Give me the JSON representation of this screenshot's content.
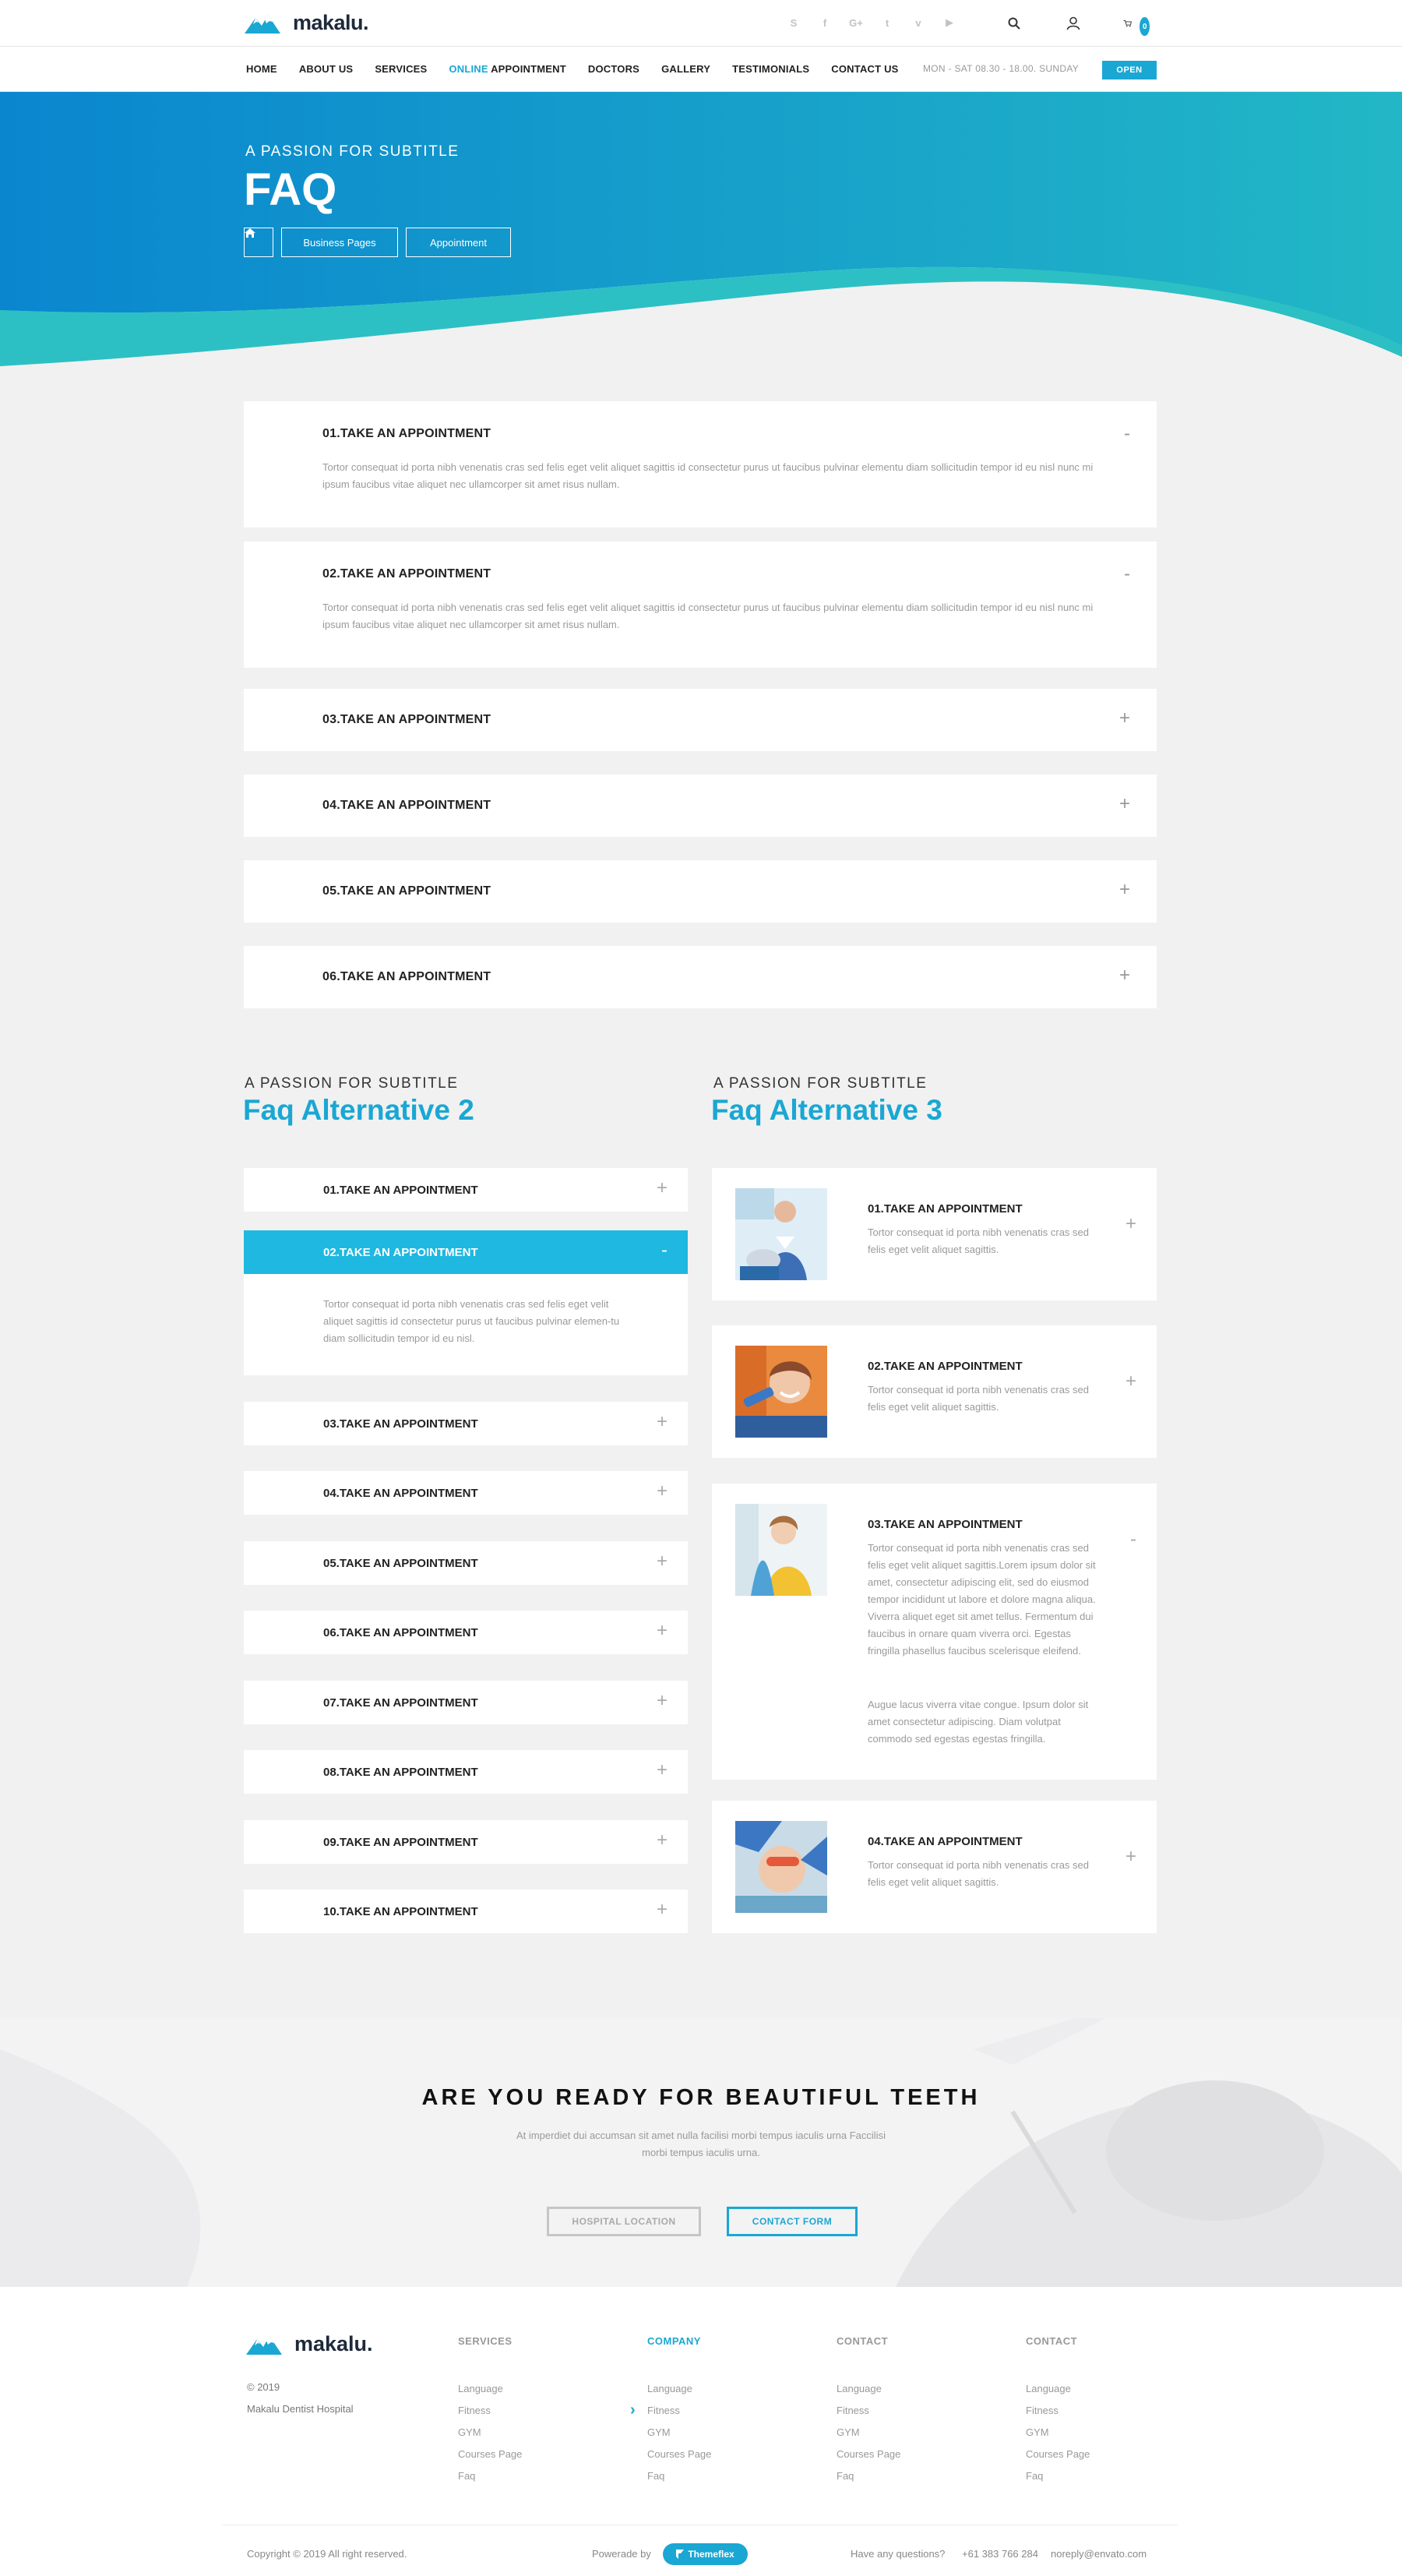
{
  "brand": {
    "name": "makalu.",
    "accent": "#1aa7d3"
  },
  "header": {
    "socials": [
      "skype-icon",
      "facebook-icon",
      "google-plus-icon",
      "twitter-icon",
      "vimeo-icon",
      "youtube-icon"
    ],
    "cart_count": "0",
    "nav": [
      {
        "label": "HOME"
      },
      {
        "label": "ABOUT US"
      },
      {
        "label": "SERVICES"
      },
      {
        "label_hl": "ONLINE",
        "label": " APPOINTMENT"
      },
      {
        "label": "DOCTORS"
      },
      {
        "label": "GALLERY"
      },
      {
        "label": "TESTIMONIALS"
      },
      {
        "label": "CONTACT US"
      }
    ],
    "hours": "MON - SAT 08.30 - 18.00. SUNDAY",
    "open_label": "OPEN"
  },
  "hero": {
    "subtitle": "A PASSION FOR SUBTITLE",
    "title": "FAQ",
    "breadcrumbs": [
      "Business Pages",
      "Appointment"
    ]
  },
  "faq_main": {
    "items": [
      {
        "q": "01.TAKE AN APPOINTMENT",
        "open": true,
        "toggle": "-",
        "a": "Tortor consequat id porta nibh venenatis cras sed felis eget velit aliquet sagittis id consectetur purus ut faucibus pulvinar elementu diam sollicitudin tempor id eu nisl nunc mi ipsum faucibus vitae aliquet nec ullamcorper sit amet risus nullam."
      },
      {
        "q": "02.TAKE AN APPOINTMENT",
        "open": true,
        "toggle": "-",
        "a": "Tortor consequat id porta nibh venenatis cras sed felis eget velit aliquet sagittis id consectetur purus ut faucibus pulvinar elementu diam sollicitudin tempor id eu nisl nunc mi ipsum faucibus vitae aliquet nec ullamcorper sit amet risus nullam."
      },
      {
        "q": "03.TAKE AN APPOINTMENT",
        "open": false,
        "toggle": "+"
      },
      {
        "q": "04.TAKE AN APPOINTMENT",
        "open": false,
        "toggle": "+"
      },
      {
        "q": "05.TAKE AN APPOINTMENT",
        "open": false,
        "toggle": "+"
      },
      {
        "q": "06.TAKE AN APPOINTMENT",
        "open": false,
        "toggle": "+"
      }
    ]
  },
  "faq_alt2": {
    "subtitle": "A PASSION FOR SUBTITLE",
    "title": "Faq Alternative 2",
    "items": [
      {
        "q": "01.TAKE AN APPOINTMENT",
        "toggle": "+"
      },
      {
        "q": "02.TAKE AN APPOINTMENT",
        "toggle": "-"
      },
      {
        "q": "03.TAKE AN APPOINTMENT",
        "toggle": "+"
      },
      {
        "q": "04.TAKE AN APPOINTMENT",
        "toggle": "+"
      },
      {
        "q": "05.TAKE AN APPOINTMENT",
        "toggle": "+"
      },
      {
        "q": "06.TAKE AN APPOINTMENT",
        "toggle": "+"
      },
      {
        "q": "07.TAKE AN APPOINTMENT",
        "toggle": "+"
      },
      {
        "q": "08.TAKE AN APPOINTMENT",
        "toggle": "+"
      },
      {
        "q": "09.TAKE AN APPOINTMENT",
        "toggle": "+"
      },
      {
        "q": "10.TAKE AN APPOINTMENT",
        "toggle": "+"
      }
    ],
    "open_answer": "Tortor consequat id porta nibh venenatis cras sed felis eget velit aliquet sagittis id consectetur purus ut faucibus pulvinar elemen-tu diam sollicitudin tempor id eu nisl."
  },
  "faq_alt3": {
    "subtitle": "A PASSION FOR SUBTITLE",
    "title": "Faq Alternative 3",
    "items": [
      {
        "q": "01.TAKE AN APPOINTMENT",
        "toggle": "+",
        "a": "Tortor consequat id porta nibh venenatis cras sed felis eget velit aliquet sagittis."
      },
      {
        "q": "02.TAKE AN APPOINTMENT",
        "toggle": "+",
        "a": "Tortor consequat id porta nibh venenatis cras sed felis eget velit aliquet sagittis."
      },
      {
        "q": "03.TAKE AN APPOINTMENT",
        "toggle": "-",
        "a": "Tortor consequat id porta nibh venenatis cras sed felis eget velit aliquet sagittis.Lorem ipsum dolor sit amet, consectetur adipiscing elit, sed do eiusmod tempor incididunt ut labore et dolore magna aliqua. Viverra aliquet eget sit amet tellus. Fermentum dui faucibus in ornare quam viverra orci. Egestas fringilla phasellus faucibus scelerisque eleifend.",
        "a2": "Augue lacus viverra vitae congue. Ipsum dolor sit amet consectetur adipiscing. Diam volutpat commodo sed egestas egestas fringilla."
      },
      {
        "q": "04.TAKE AN APPOINTMENT",
        "toggle": "+",
        "a": "Tortor consequat id porta nibh venenatis cras sed felis eget velit aliquet sagittis."
      }
    ]
  },
  "cta": {
    "title": "ARE YOU READY FOR BEAUTIFUL TEETH",
    "text": "At imperdiet dui accumsan sit amet nulla facilisi morbi tempus iaculis urna Faccilisi morbi tempus iaculis urna.",
    "btn_location": "HOSPITAL LOCATION",
    "btn_contact": "CONTACT FORM"
  },
  "footer": {
    "year": "© 2019",
    "company": "Makalu Dentist Hospital",
    "columns": [
      {
        "title": "SERVICES",
        "links": [
          "Language",
          "Fitness",
          "GYM",
          "Courses Page",
          "Faq"
        ]
      },
      {
        "title": "COMPANY",
        "links": [
          "Language",
          "Fitness",
          "GYM",
          "Courses Page",
          "Faq"
        ]
      },
      {
        "title": "CONTACT",
        "links": [
          "Language",
          "Fitness",
          "GYM",
          "Courses Page",
          "Faq"
        ]
      },
      {
        "title": "CONTACT",
        "links": [
          "Language",
          "Fitness",
          "GYM",
          "Courses Page",
          "Faq"
        ]
      }
    ],
    "copyright": "Copyright © 2019 All right reserved.",
    "powered_by": "Powerade by",
    "themeflex": "Themeflex",
    "question": "Have any questions?",
    "phone": "+61 383 766 284",
    "email": "noreply@envato.com"
  }
}
